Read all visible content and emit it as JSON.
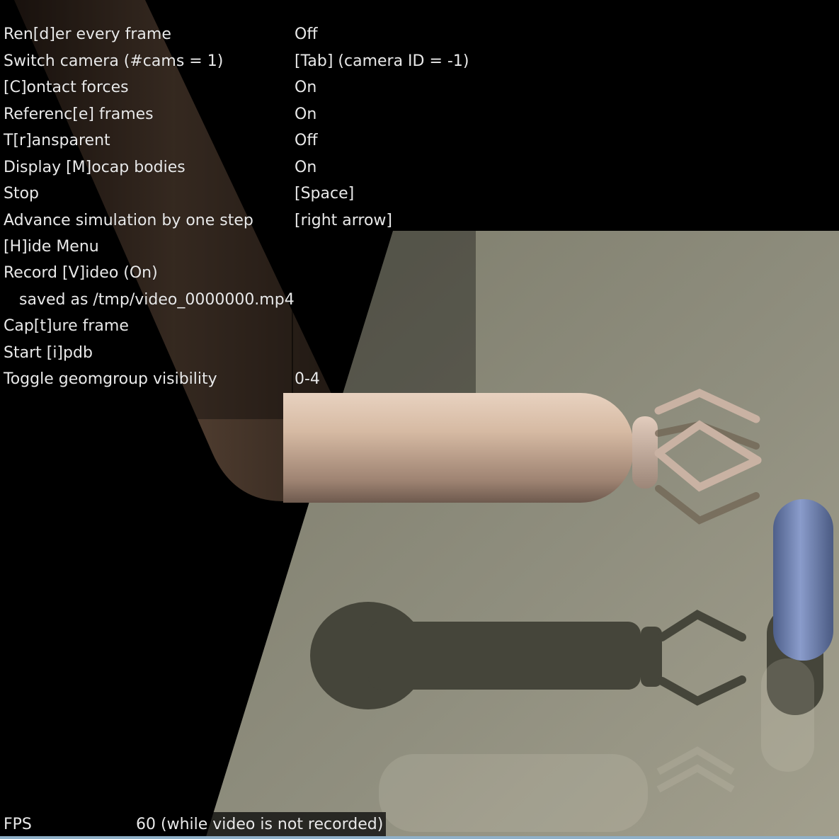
{
  "menu": {
    "items": [
      {
        "label": "Ren[d]er every frame",
        "value": "Off"
      },
      {
        "label": "Switch camera (#cams = 1)",
        "value": "[Tab] (camera ID = -1)"
      },
      {
        "label": "[C]ontact forces",
        "value": "On"
      },
      {
        "label": "Referenc[e] frames",
        "value": "On"
      },
      {
        "label": "T[r]ansparent",
        "value": "Off"
      },
      {
        "label": "Display [M]ocap bodies",
        "value": "On"
      },
      {
        "label": "Stop",
        "value": "[Space]"
      },
      {
        "label": "Advance simulation by one step",
        "value": "[right arrow]"
      },
      {
        "label": "[H]ide Menu",
        "value": ""
      },
      {
        "label": "Record [V]ideo (On)",
        "value": ""
      },
      {
        "label": "saved as /tmp/video_0000000.mp4",
        "value": ""
      },
      {
        "label": "Cap[t]ure frame",
        "value": ""
      },
      {
        "label": "Start [i]pdb",
        "value": ""
      },
      {
        "label": "Toggle geomgroup visibility",
        "value": "0-4"
      }
    ]
  },
  "status": {
    "fps_label": "FPS",
    "fps_value": "60 (while video is not recorded)"
  },
  "colors": {
    "floor": "#8e8d7c",
    "arm": "#c9ad98",
    "object": "#6d80b0",
    "shadow": "#45453a"
  }
}
